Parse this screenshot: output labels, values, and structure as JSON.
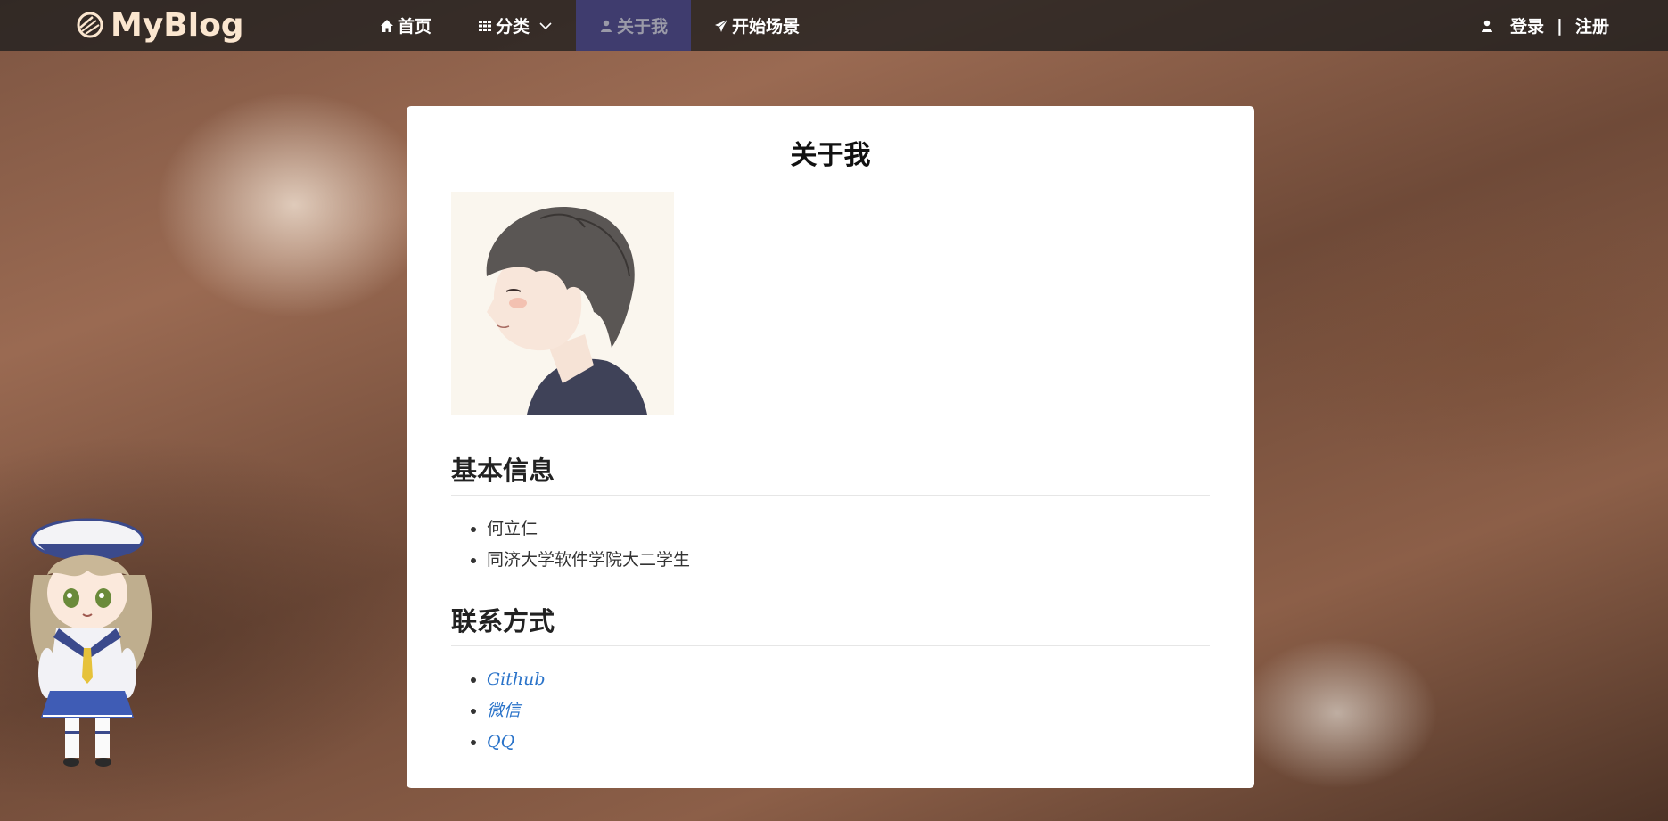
{
  "navbar": {
    "brand": "MyBlog",
    "items": [
      {
        "label": "首页",
        "icon": "home-icon"
      },
      {
        "label": "分类",
        "icon": "grid-icon"
      },
      {
        "label": "关于我",
        "icon": "user-icon"
      },
      {
        "label": "开始场景",
        "icon": "paper-plane-icon"
      }
    ],
    "active_item": "关于我",
    "login_label": "登录",
    "separator": "|",
    "register_label": "注册"
  },
  "about": {
    "title": "关于我",
    "basic_info_heading": "基本信息",
    "basic_info": [
      "何立仁",
      "同济大学软件学院大二学生"
    ],
    "contact_heading": "联系方式",
    "contacts": [
      "Github",
      "微信",
      "QQ"
    ]
  },
  "colors": {
    "brand": "#fbe6cf",
    "active_nav": "#3f3c6e",
    "link": "#2a73c9"
  }
}
